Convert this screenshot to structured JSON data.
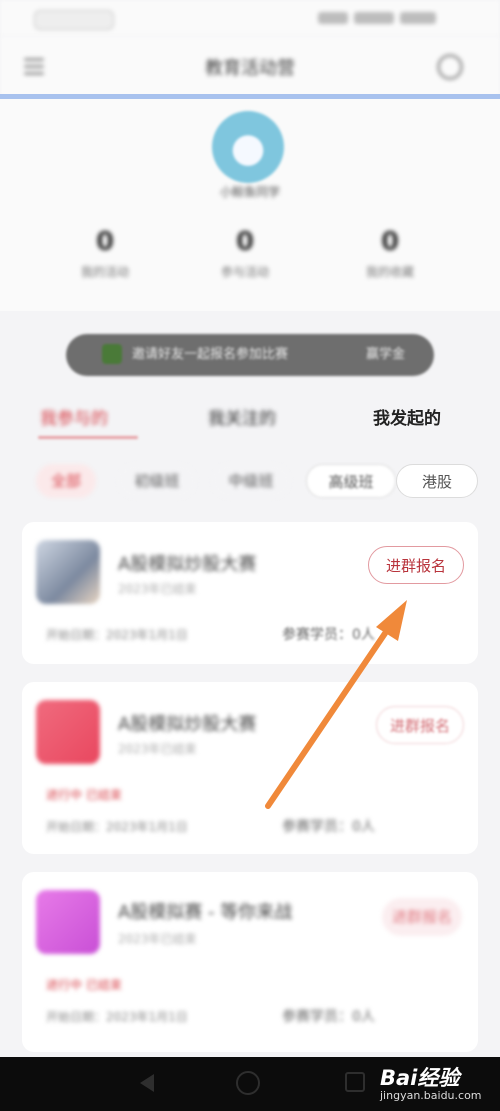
{
  "status_bar": {
    "left": "",
    "right": ""
  },
  "nav": {
    "title": "教育活动营"
  },
  "profile": {
    "username": "小鲸鱼同学",
    "stats": [
      {
        "value": "0",
        "label": "我的活动"
      },
      {
        "value": "0",
        "label": "参与活动"
      },
      {
        "value": "0",
        "label": "我的收藏"
      }
    ]
  },
  "banner": {
    "text": "邀请好友一起报名参加比赛",
    "text2": "赢学金"
  },
  "tabs": [
    {
      "label": "我参与的"
    },
    {
      "label": "我关注的"
    },
    {
      "label": "我发起的"
    }
  ],
  "filters": [
    {
      "label": "全部"
    },
    {
      "label": "初级班"
    },
    {
      "label": "中级班"
    },
    {
      "label": "高级班"
    },
    {
      "label": "港股"
    }
  ],
  "cards": [
    {
      "title": "A股模拟炒股大赛",
      "subtitle": "2023年已结束",
      "meta": "开始日期：2023年1月1日",
      "participants_label": "参赛学员：0人",
      "button": "进群报名"
    },
    {
      "title": "A股模拟炒股大赛",
      "subtitle": "2023年已结束",
      "tag": "进行中  已结束",
      "meta": "开始日期：2023年1月1日",
      "participants_label": "参赛学员：0人",
      "button": "进群报名"
    },
    {
      "title": "A股模拟赛 - 等你来战",
      "subtitle": "2023年已结束",
      "tag": "进行中  已结束",
      "meta": "开始日期：2023年1月1日",
      "participants_label": "参赛学员：0人",
      "button": "进群报名"
    }
  ],
  "annotation": {
    "color": "#f0893a"
  },
  "watermark": {
    "logo": "Bai经验",
    "sub": "jingyan.baidu.com"
  },
  "colors": {
    "accent": "#d8434b",
    "nav_line": "#a8c2ee",
    "bottom_bar": "#0c0c0c"
  },
  "icons": [
    "menu-icon",
    "settings-icon",
    "back-icon",
    "home-icon",
    "recent-apps-icon",
    "coin-icon"
  ]
}
